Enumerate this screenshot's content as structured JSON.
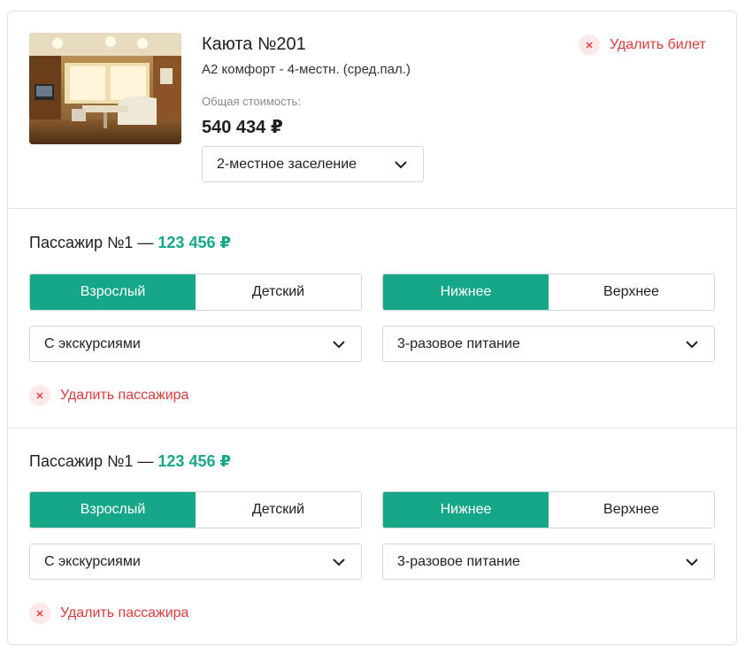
{
  "ticket": {
    "cabin_title": "Каюта №201",
    "cabin_class": "А2 комфорт - 4-местн. (сред.пал.)",
    "total_label": "Общая стоимость:",
    "total_value": "540 434 ₽",
    "occupancy_select": "2-местное заселение",
    "delete_ticket_label": "Удалить билет"
  },
  "passengers": [
    {
      "title": "Пассажир №1 —",
      "price": "123 456 ₽",
      "age_options": [
        "Взрослый",
        "Детский"
      ],
      "age_selected": "Взрослый",
      "berth_options": [
        "Нижнее",
        "Верхнее"
      ],
      "berth_selected": "Нижнее",
      "excursion_select": "С экскурсиями",
      "meal_select": "3-разовое питание",
      "delete_label": "Удалить пассажира"
    },
    {
      "title": "Пассажир №1 —",
      "price": "123 456 ₽",
      "age_options": [
        "Взрослый",
        "Детский"
      ],
      "age_selected": "Взрослый",
      "berth_options": [
        "Нижнее",
        "Верхнее"
      ],
      "berth_selected": "Нижнее",
      "excursion_select": "С экскурсиями",
      "meal_select": "3-разовое питание",
      "delete_label": "Удалить пассажира"
    }
  ],
  "colors": {
    "accent": "#16a788",
    "danger": "#e03a3a",
    "danger_bg": "#fde9e9",
    "border": "#d6d6d6"
  },
  "icons": {
    "chevron": "chevron-down-icon",
    "close": "close-icon",
    "photo": "cabin-photo"
  }
}
